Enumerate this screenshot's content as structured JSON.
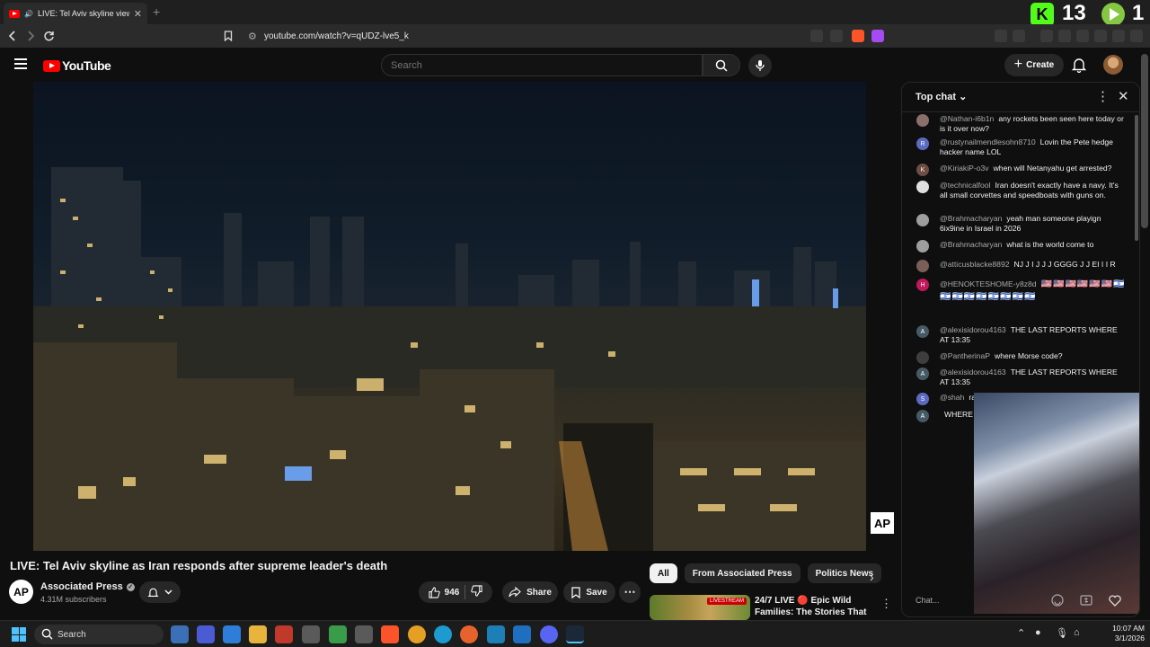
{
  "browser": {
    "tab_title": "LIVE: Tel Aviv skyline view as Ir",
    "url": "youtube.com/watch?v=qUDZ-lve5_k",
    "overlay_count_1": "13",
    "overlay_count_2": "1"
  },
  "header": {
    "logo_text": "YouTube",
    "search_placeholder": "Search",
    "create_label": "Create"
  },
  "video": {
    "title": "LIVE: Tel Aviv skyline as Iran responds after supreme leader's death",
    "watermark": "AP"
  },
  "channel": {
    "avatar_text": "AP",
    "name": "Associated Press",
    "subscribers": "4.31M subscribers"
  },
  "actions": {
    "likes": "946",
    "share_label": "Share",
    "save_label": "Save"
  },
  "chips": [
    "All",
    "From Associated Press",
    "Politics News"
  ],
  "recommendation": {
    "title_line1": "24/7 LIVE 🔴 Epic Wild",
    "title_line2": "Families: The Stories That ...",
    "badge": "LIVESTREAM"
  },
  "chat": {
    "header": "Top chat",
    "input_placeholder": "Chat...",
    "messages": [
      {
        "author": "@Nathan-i6b1n",
        "text": "any rockets been seen here today or is it over now?",
        "avatar": "",
        "color": "#8a6f6a"
      },
      {
        "author": "@rustynailmendlesohn8710",
        "text": "Lovin the Pete hedge hacker name LOL",
        "avatar": "R",
        "color": "#5c6bc0"
      },
      {
        "author": "@KiriakiP-o3v",
        "text": "when will Netanyahu get arrested?",
        "avatar": "K",
        "color": "#6d4c41"
      },
      {
        "author": "@technicalfool",
        "text": "Iran doesn't exactly have a navy. It's all small corvettes and speedboats with guns on.",
        "avatar": "",
        "color": "#e0e0e0"
      },
      {
        "author": "@Brahmacharyan",
        "text": "yeah man someone playign 6ix9ine in Israel in 2026",
        "avatar": "",
        "color": "#9e9e9e"
      },
      {
        "author": "@Brahmacharyan",
        "text": "what is the world come to",
        "avatar": "",
        "color": "#9e9e9e"
      },
      {
        "author": "@atticusblacke8892",
        "text": "NJ J I J J J GGGG J J EI I I R",
        "avatar": "",
        "color": "#7b5e57"
      },
      {
        "author": "@HENOKTESHOME-y8z8d",
        "text": "🇺🇸🇺🇸🇺🇸🇺🇸🇺🇸🇺🇸🇮🇱🇮🇱🇮🇱🇮🇱🇮🇱🇮🇱🇮🇱🇮🇱🇮🇱",
        "avatar": "H",
        "color": "#c2185b"
      },
      {
        "author": "@alexisidorou4163",
        "text": "THE LAST REPORTS WHERE AT 13:35",
        "avatar": "A",
        "color": "#455a64"
      },
      {
        "author": "@PantherinaP",
        "text": "where Morse code?",
        "avatar": "",
        "color": "#3e3e3e"
      },
      {
        "author": "@alexisidorou4163",
        "text": "THE LAST REPORTS WHERE AT 13:35",
        "avatar": "A",
        "color": "#455a64"
      },
      {
        "author": "@shah",
        "text": "rael?",
        "avatar": "S",
        "color": "#5c6bc0"
      },
      {
        "author": "",
        "text": "WHERE",
        "avatar": "A",
        "color": "#455a64"
      }
    ]
  },
  "taskbar": {
    "search_label": "Search",
    "time": "10:07 AM",
    "date": "3/1/2026"
  },
  "colors": {
    "yt_red": "#ff0000",
    "bg": "#0f0f0f",
    "surface": "#272727"
  }
}
